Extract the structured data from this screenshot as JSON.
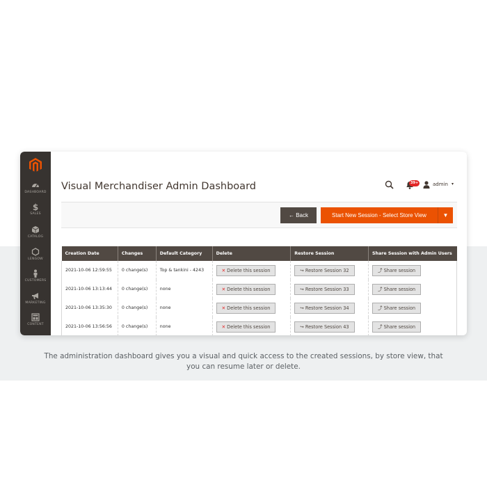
{
  "page": {
    "caption": "The administration dashboard gives you a visual and quick access to the created sessions, by store view, that you can resume later or delete."
  },
  "sidebar": {
    "items": [
      {
        "label": "DASHBOARD",
        "icon": "dashboard-icon"
      },
      {
        "label": "SALES",
        "icon": "dollar-icon"
      },
      {
        "label": "CATALOG",
        "icon": "box-icon"
      },
      {
        "label": "LENGOW",
        "icon": "hexagon-icon"
      },
      {
        "label": "CUSTOMERS",
        "icon": "person-icon"
      },
      {
        "label": "MARKETING",
        "icon": "megaphone-icon"
      },
      {
        "label": "CONTENT",
        "icon": "layout-icon"
      }
    ]
  },
  "header": {
    "title": "Visual Merchandiser Admin Dashboard",
    "notifications_count": "39+",
    "user": "admin"
  },
  "toolbar": {
    "back_label": "Back",
    "start_label": "Start New Session - Select Store View"
  },
  "table": {
    "columns": [
      "Creation Date",
      "Changes",
      "Default Category",
      "Delete",
      "Restore Session",
      "Share Session with Admin Users"
    ],
    "rows": [
      {
        "date": "2021-10-06 12:59:55",
        "changes": "0 change(s)",
        "category": "Top & tankini - 4243",
        "delete": "Delete this session",
        "restore": "Restore Session 32",
        "share": "Share session"
      },
      {
        "date": "2021-10-06 13:13:44",
        "changes": "0 change(s)",
        "category": "none",
        "delete": "Delete this session",
        "restore": "Restore Session 33",
        "share": "Share session"
      },
      {
        "date": "2021-10-06 13:35:30",
        "changes": "0 change(s)",
        "category": "none",
        "delete": "Delete this session",
        "restore": "Restore Session 34",
        "share": "Share session"
      },
      {
        "date": "2021-10-06 13:56:56",
        "changes": "0 change(s)",
        "category": "none",
        "delete": "Delete this session",
        "restore": "Restore Session 43",
        "share": "Share session"
      }
    ]
  },
  "colors": {
    "sidebar": "#373330",
    "accent": "#eb5202",
    "header_dark": "#514943",
    "band": "#eef0f1"
  }
}
